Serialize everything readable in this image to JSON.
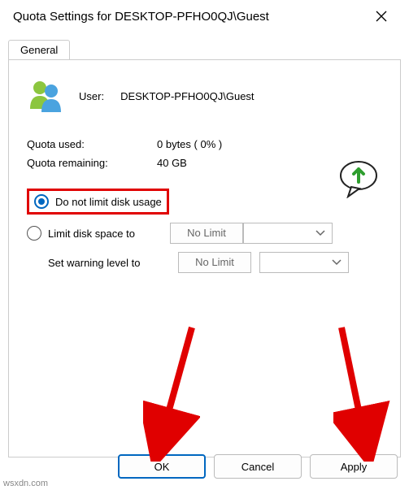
{
  "window": {
    "title": "Quota Settings for DESKTOP-PFHO0QJ\\Guest"
  },
  "tabs": {
    "general": "General"
  },
  "user": {
    "label": "User:",
    "value": "DESKTOP-PFHO0QJ\\Guest"
  },
  "quota": {
    "used_label": "Quota used:",
    "used_value": "0 bytes ( 0% )",
    "remaining_label": "Quota remaining:",
    "remaining_value": "40 GB"
  },
  "options": {
    "no_limit": "Do not limit disk usage",
    "limit_to": "Limit disk space to",
    "warning": "Set warning level to",
    "nolimit_text": "No Limit"
  },
  "buttons": {
    "ok": "OK",
    "cancel": "Cancel",
    "apply": "Apply"
  },
  "watermark": "wsxdn.com",
  "annotation": {
    "highlight_color": "#e00000",
    "arrow_color": "#e00000"
  }
}
